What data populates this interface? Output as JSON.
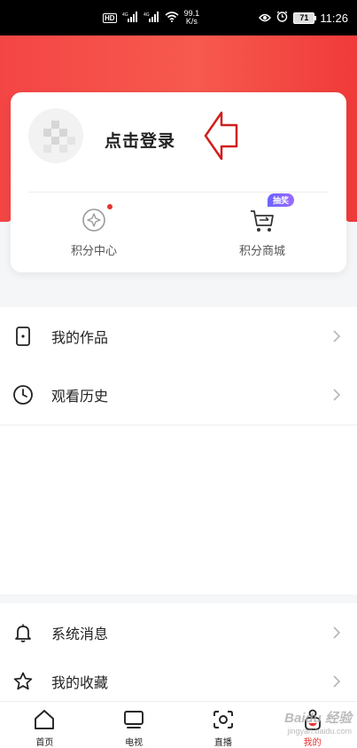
{
  "status_bar": {
    "hd": "HD",
    "signal_labels": [
      "4G",
      "4G"
    ],
    "net_speed": "99.1",
    "net_unit": "K/s",
    "battery": "71",
    "time": "11:26"
  },
  "profile": {
    "login_label": "点击登录",
    "actions": [
      {
        "label": "积分中心",
        "icon": "points-center-icon",
        "has_dot": true
      },
      {
        "label": "积分商城",
        "icon": "shopping-cart-icon",
        "badge": "抽奖"
      }
    ]
  },
  "menu": [
    {
      "label": "我的作品",
      "icon": "works-icon"
    },
    {
      "label": "观看历史",
      "icon": "clock-icon"
    },
    {
      "label": "系统消息",
      "icon": "bell-icon"
    },
    {
      "label": "我的收藏",
      "icon": "star-icon"
    }
  ],
  "bottom_nav": [
    {
      "label": "首页",
      "icon": "home-icon"
    },
    {
      "label": "电视",
      "icon": "tv-icon"
    },
    {
      "label": "直播",
      "icon": "live-icon"
    },
    {
      "label": "我的",
      "icon": "profile-icon",
      "active": true
    }
  ],
  "watermark": {
    "line1": "Baidu 经验",
    "line2": "jingyan.baidu.com"
  },
  "colors": {
    "brand_red": "#f44545",
    "accent_red": "#e83232",
    "badge_purple": "#7a66ff"
  }
}
